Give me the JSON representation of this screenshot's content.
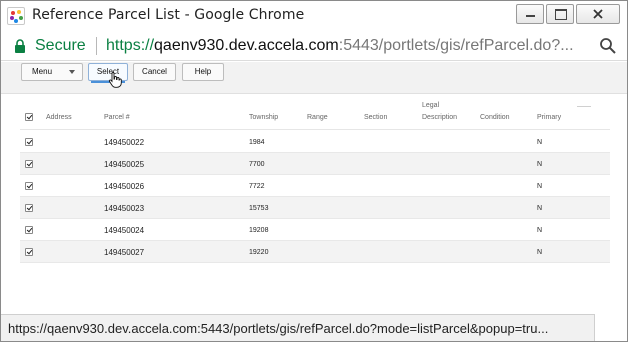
{
  "window": {
    "title": "Reference Parcel List - Google Chrome",
    "app_icon": "accela-logo-icon"
  },
  "address_bar": {
    "secure_label": "Secure",
    "url_scheme": "https://",
    "url_host": "qaenv930.dev.accela.com",
    "url_rest": ":5443/portlets/gis/refParcel.do?...",
    "icons": [
      "lock-icon",
      "zoom-icon"
    ]
  },
  "toolbar": {
    "menu_label": "Menu",
    "select_label": "Select",
    "cancel_label": "Cancel",
    "help_label": "Help"
  },
  "table": {
    "headers": {
      "address": "Address",
      "parcel": "Parcel #",
      "township": "Township",
      "range": "Range",
      "section": "Section",
      "legal_line1": "Legal",
      "legal_line2": "Description",
      "condition": "Condition",
      "primary": "Primary"
    },
    "rows": [
      {
        "parcel": "149450022",
        "township": "1984",
        "primary": "N",
        "checked": true
      },
      {
        "parcel": "149450025",
        "township": "7700",
        "primary": "N",
        "checked": true
      },
      {
        "parcel": "149450026",
        "township": "7722",
        "primary": "N",
        "checked": true
      },
      {
        "parcel": "149450023",
        "township": "15753",
        "primary": "N",
        "checked": true
      },
      {
        "parcel": "149450024",
        "township": "19208",
        "primary": "N",
        "checked": true
      },
      {
        "parcel": "149450027",
        "township": "19220",
        "primary": "N",
        "checked": true
      }
    ]
  },
  "status_bar": {
    "text": "https://qaenv930.dev.accela.com:5443/portlets/gis/refParcel.do?mode=listParcel&popup=tru..."
  },
  "colors": {
    "secure_green": "#0b8043",
    "select_accent": "#4a90d9",
    "row_alt": "#f3f3f3"
  }
}
